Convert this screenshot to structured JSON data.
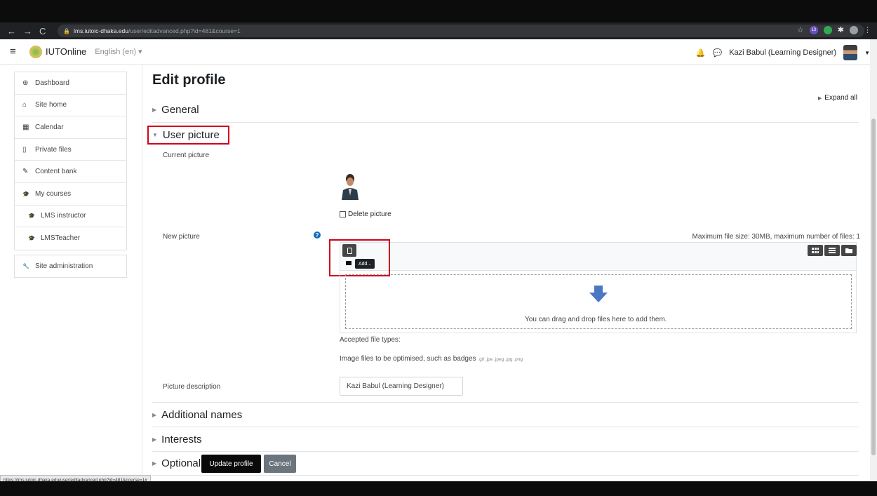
{
  "browser": {
    "url_host": "lms.iutoic-dhaka.edu",
    "url_path": "/user/editadvanced.php?id=481&course=1",
    "status_url": "https://lms.iutoic-dhaka.edu/user/editadvanced.php?id=481&course=1#",
    "ext_badge": "13"
  },
  "navbar": {
    "site_name": "IUTOnline",
    "language": "English (en) ▾",
    "user_name": "Kazi Babul (Learning Designer)"
  },
  "sidebar": {
    "main": [
      {
        "label": "Dashboard",
        "icon": "tachometer-icon",
        "glyph": "⊛"
      },
      {
        "label": "Site home",
        "icon": "home-icon",
        "glyph": "⌂"
      },
      {
        "label": "Calendar",
        "icon": "calendar-icon",
        "glyph": "▦"
      },
      {
        "label": "Private files",
        "icon": "file-icon",
        "glyph": "▯"
      },
      {
        "label": "Content bank",
        "icon": "paint-brush-icon",
        "glyph": "✎"
      },
      {
        "label": "My courses",
        "icon": "graduation-cap-icon",
        "glyph": "🎓"
      },
      {
        "label": "LMS instructor",
        "icon": "graduation-cap-icon",
        "glyph": "🎓"
      },
      {
        "label": "LMSTeacher",
        "icon": "graduation-cap-icon",
        "glyph": "🎓"
      }
    ],
    "admin": {
      "label": "Site administration",
      "icon": "wrench-icon",
      "glyph": "🔧"
    }
  },
  "main": {
    "title": "Edit profile",
    "expand_all": "Expand all",
    "sections": {
      "general": "General",
      "user_picture": "User picture",
      "additional_names": "Additional names",
      "interests": "Interests",
      "optional": "Optional"
    },
    "fields": {
      "current_picture": "Current picture",
      "delete_picture": "Delete picture",
      "new_picture": "New picture",
      "max_size": "Maximum file size: 30MB, maximum number of files: 1",
      "add_tooltip": "Add...",
      "drop_text": "You can drag and drop files here to add them.",
      "accepted_types": "Accepted file types:",
      "file_types_desc": "Image files to be optimised, such as badges",
      "file_types_ext": ".gif .jpe .jpeg .jpg .png",
      "picture_description": "Picture description",
      "picture_description_value": "Kazi Babul (Learning Designer)"
    },
    "buttons": {
      "update": "Update profile",
      "cancel": "Cancel"
    }
  },
  "colors": {
    "highlight": "#d0021b",
    "primary": "#0f6cbf",
    "dark_button": "#0a0a0a",
    "secondary_button": "#6c757d"
  }
}
